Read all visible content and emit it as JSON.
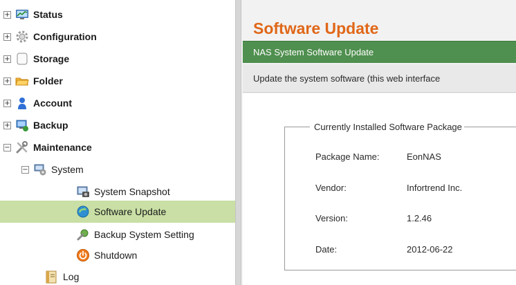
{
  "sidebar": {
    "items": [
      {
        "label": "Status",
        "icon": "monitor-chart-icon",
        "expander": "+"
      },
      {
        "label": "Configuration",
        "icon": "gear-icon",
        "expander": "+"
      },
      {
        "label": "Storage",
        "icon": "disk-icon",
        "expander": "+"
      },
      {
        "label": "Folder",
        "icon": "folder-icon",
        "expander": "+"
      },
      {
        "label": "Account",
        "icon": "user-icon",
        "expander": "+"
      },
      {
        "label": "Backup",
        "icon": "backup-icon",
        "expander": "+"
      },
      {
        "label": "Maintenance",
        "icon": "tools-icon",
        "expander": "−"
      },
      {
        "label": "System",
        "icon": "system-icon",
        "expander": "−"
      },
      {
        "label": "System Snapshot",
        "icon": "snapshot-icon"
      },
      {
        "label": "Software Update",
        "icon": "software-update-icon",
        "selected": true
      },
      {
        "label": "Backup System Setting",
        "icon": "backup-setting-icon"
      },
      {
        "label": "Shutdown",
        "icon": "power-icon"
      },
      {
        "label": "Log",
        "icon": "log-icon"
      }
    ]
  },
  "main": {
    "title": "Software Update",
    "panel_title": "NAS System Software Update",
    "description": "Update the system software (this web interface",
    "installed": {
      "legend": "Currently Installed Software Package",
      "rows": [
        {
          "label": "Package Name:",
          "value": "EonNAS"
        },
        {
          "label": "Vendor:",
          "value": "Infortrend Inc."
        },
        {
          "label": "Version:",
          "value": "1.2.46"
        },
        {
          "label": "Date:",
          "value": "2012-06-22"
        }
      ]
    }
  },
  "colors": {
    "title_orange": "#e06718",
    "panel_green": "#4f8f4f",
    "selected_row": "#c9dfa5"
  }
}
